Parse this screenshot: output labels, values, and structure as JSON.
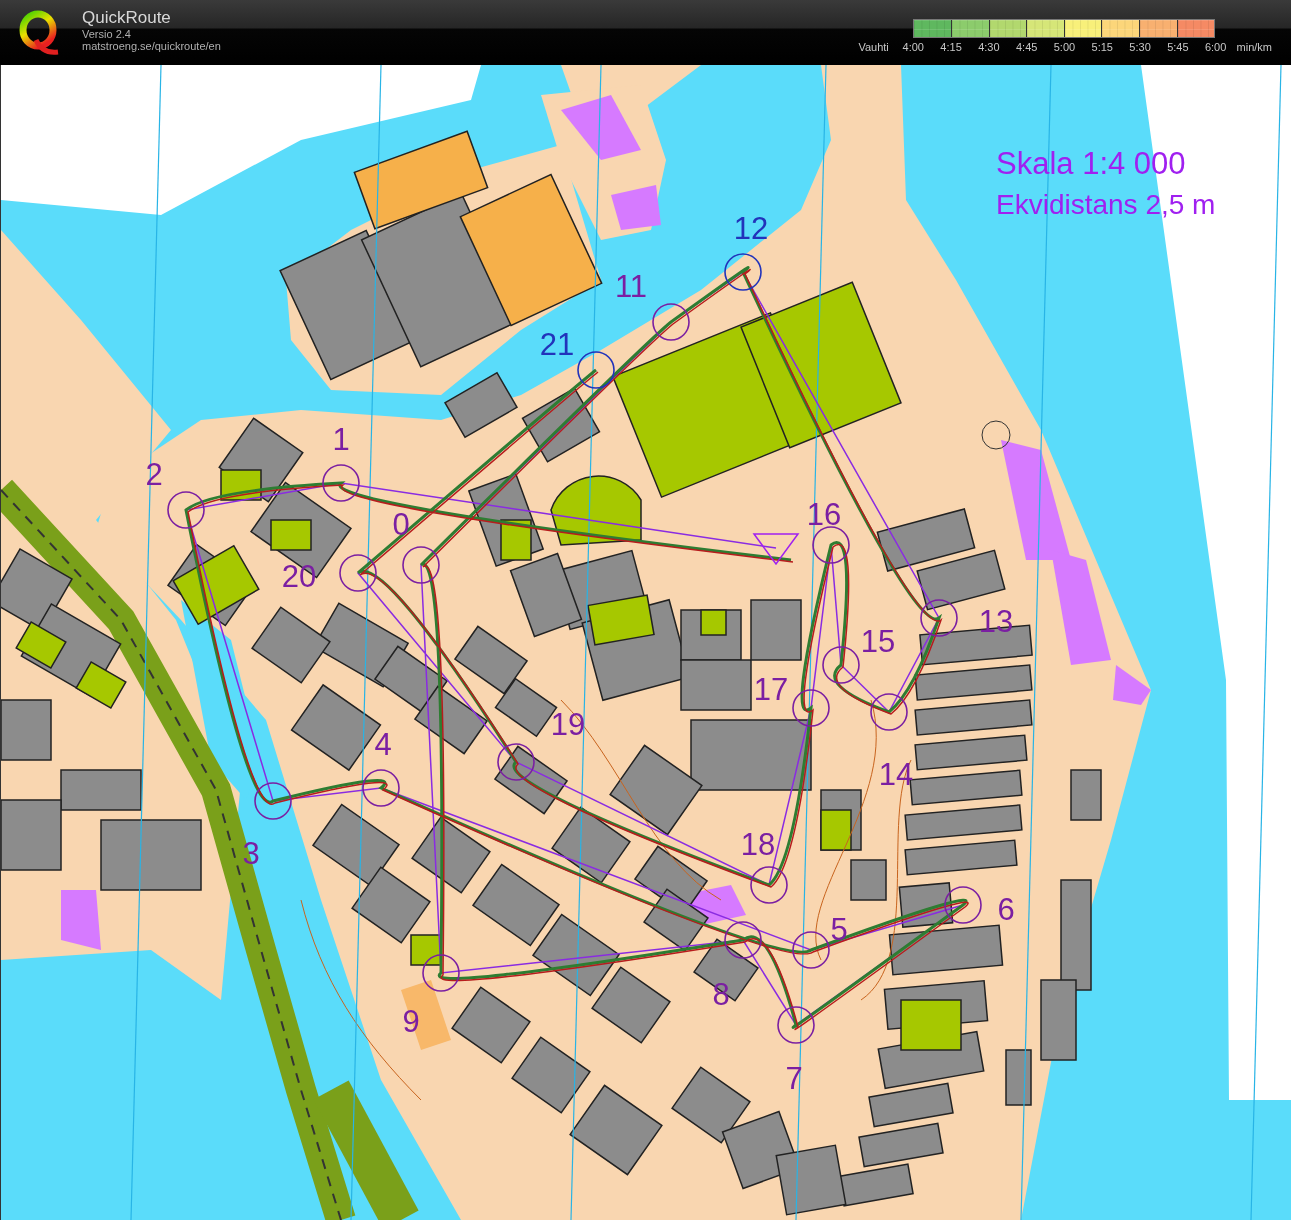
{
  "header": {
    "title": "QuickRoute",
    "version": "Versio 2.4",
    "url": "matstroeng.se/quickroute/en"
  },
  "pace_legend": {
    "label": "Vauhti",
    "ticks": [
      "4:00",
      "4:15",
      "4:30",
      "4:45",
      "5:00",
      "5:15",
      "5:30",
      "5:45",
      "6:00"
    ],
    "unit": "min/km"
  },
  "map": {
    "scale_text": "Skala 1:4 000",
    "contour_text": "Ekvidistans 2,5 m",
    "controls": [
      {
        "label": "1",
        "color": "#7b1fa2"
      },
      {
        "label": "2",
        "color": "#7b1fa2"
      },
      {
        "label": "3",
        "color": "#7b1fa2"
      },
      {
        "label": "4",
        "color": "#7b1fa2"
      },
      {
        "label": "5",
        "color": "#7b1fa2"
      },
      {
        "label": "6",
        "color": "#7b1fa2"
      },
      {
        "label": "7",
        "color": "#7b1fa2"
      },
      {
        "label": "8",
        "color": "#7b1fa2"
      },
      {
        "label": "9",
        "color": "#7b1fa2"
      },
      {
        "label": "0",
        "color": "#7b1fa2"
      },
      {
        "label": "11",
        "color": "#7b1fa2"
      },
      {
        "label": "12",
        "color": "#2233bb"
      },
      {
        "label": "13",
        "color": "#7b1fa2"
      },
      {
        "label": "14",
        "color": "#7b1fa2"
      },
      {
        "label": "15",
        "color": "#7b1fa2"
      },
      {
        "label": "16",
        "color": "#7b1fa2"
      },
      {
        "label": "17",
        "color": "#7b1fa2"
      },
      {
        "label": "18",
        "color": "#7b1fa2"
      },
      {
        "label": "19",
        "color": "#7b1fa2"
      },
      {
        "label": "20",
        "color": "#7b1fa2"
      },
      {
        "label": "21",
        "color": "#2233bb"
      }
    ]
  }
}
